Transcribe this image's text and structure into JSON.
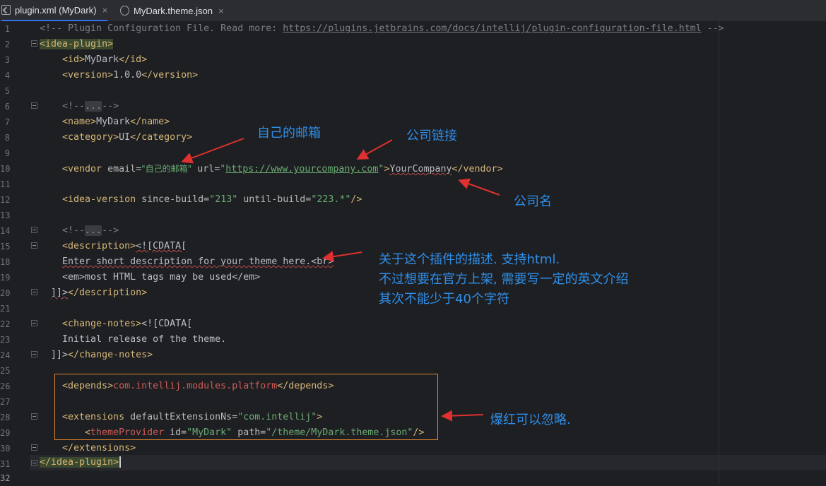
{
  "tabs": [
    {
      "label": "plugin.xml (MyDark)",
      "icon": "xml-file-icon",
      "active": true
    },
    {
      "label": "MyDark.theme.json",
      "icon": "json-file-icon",
      "active": false
    }
  ],
  "close_glyph": "×",
  "line_numbers": [
    "1",
    "2",
    "3",
    "4",
    "5",
    "6",
    "7",
    "8",
    "9",
    "10",
    "11",
    "12",
    "13",
    "14",
    "15",
    "18",
    "19",
    "20",
    "21",
    "22",
    "23",
    "24",
    "25",
    "26",
    "27",
    "28",
    "29",
    "30",
    "31",
    "32"
  ],
  "code": {
    "l1": {
      "prefix": "<!-- Plugin Configuration File. Read more: ",
      "url": "https://plugins.jetbrains.com/docs/intellij/plugin-configuration-file.html",
      "suffix": " -->"
    },
    "l2": "idea-plugin",
    "l3": {
      "tag": "id",
      "value": "MyDark"
    },
    "l4": {
      "tag": "version",
      "value": "1.0.0"
    },
    "fold_comment": {
      "open": "<!--",
      "dots": "...",
      "close": "-->"
    },
    "l7": {
      "tag": "name",
      "value": "MyDark"
    },
    "l8": {
      "tag": "category",
      "value": "UI"
    },
    "l11": {
      "tag": "vendor",
      "attr_email": "email",
      "email": "\"自己的邮箱\"",
      "attr_url": "url",
      "url_q": "\"",
      "url": "https://www.yourcompany.com",
      "value": "YourCompany"
    },
    "l13": {
      "tag": "idea-version",
      "attr1": "since-build",
      "v1": "\"213\"",
      "attr2": "until-build",
      "v2": "\"223.*\""
    },
    "l18": {
      "tag": "description",
      "cdata": "<![CDATA["
    },
    "l19": "Enter short description for your theme here.<br>",
    "l20": "<em>most HTML tags may be used</em>",
    "l21": {
      "end": "]]>",
      "tag": "description"
    },
    "l23": {
      "tag": "change-notes",
      "cdata": "<![CDATA["
    },
    "l24": "Initial release of the theme.",
    "l25": {
      "end": "]]>",
      "tag": "change-notes"
    },
    "l27": {
      "tag": "depends",
      "value": "com.intellij.modules.platform"
    },
    "l29": {
      "tag": "extensions",
      "attr": "defaultExtensionNs",
      "v": "\"com.intellij\""
    },
    "l30": {
      "tag": "themeProvider",
      "attr1": "id",
      "v1": "\"MyDark\"",
      "attr2": "path",
      "v2": "\"/theme/MyDark.theme.json\""
    },
    "l31": "extensions",
    "l32": "idea-plugin"
  },
  "annotations": {
    "email": "自己的邮箱",
    "company_link": "公司链接",
    "company_name": "公司名",
    "description_lines": [
      "关于这个插件的描述. 支持html.",
      "不过想要在官方上架, 需要写一定的英文介绍",
      "其次不能少于40个字符"
    ],
    "ignore_red": "爆红可以忽略."
  },
  "colors": {
    "background": "#1e1f22",
    "tag": "#d5b778",
    "string": "#6aab73",
    "comment": "#7a7e85",
    "annotation_text": "#2f8ee8",
    "annotation_arrow": "#e03030",
    "highlight_box": "#e0852f"
  }
}
